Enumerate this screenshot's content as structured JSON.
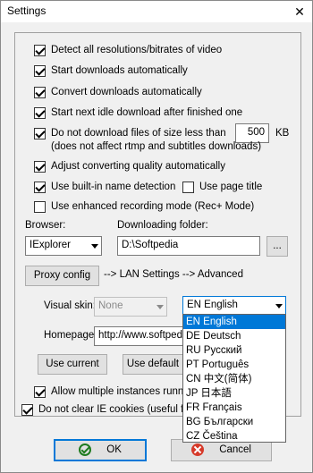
{
  "window": {
    "title": "Settings",
    "close_glyph": "✕"
  },
  "options": {
    "detect_all": {
      "label": "Detect all resolutions/bitrates of video",
      "checked": true
    },
    "start_auto": {
      "label": "Start downloads automatically",
      "checked": true
    },
    "convert_auto": {
      "label": "Convert downloads automatically",
      "checked": true
    },
    "start_next_idle": {
      "label": "Start next idle download after finished one",
      "checked": true
    },
    "no_small_files": {
      "label": "Do not download files of size less than",
      "checked": true,
      "value": "500",
      "unit": "KB",
      "note": "(does not affect rtmp and subtitles downloads)"
    },
    "adjust_quality": {
      "label": "Adjust converting quality automatically",
      "checked": true
    },
    "name_detection": {
      "label": "Use built-in name detection",
      "checked": true
    },
    "page_title": {
      "label": "Use page title",
      "checked": false
    },
    "enhanced_recording": {
      "label": "Use enhanced recording mode (Rec+ Mode)",
      "checked": false
    },
    "multiple_instances": {
      "label": "Allow multiple instances running",
      "checked": true
    },
    "ie_cookies": {
      "label": "Do not clear IE cookies (useful for",
      "checked": true
    }
  },
  "browser": {
    "label": "Browser:",
    "value": "IExplorer"
  },
  "folder": {
    "label": "Downloading folder:",
    "value": "D:\\Softpedia",
    "browse_label": "..."
  },
  "proxy": {
    "button_label": "Proxy config",
    "hint": "--> LAN Settings --> Advanced"
  },
  "visual_skin": {
    "label": "Visual skin:",
    "value": "None"
  },
  "language": {
    "value": "EN English",
    "options": [
      "EN English",
      "DE Deutsch",
      "RU Русский",
      "PT Português",
      "CN 中文(简体)",
      "JP 日本語",
      "FR Français",
      "BG Български",
      "CZ Čeština"
    ],
    "selected_index": 0
  },
  "homepage": {
    "label": "Homepage:",
    "value": "http://www.softpedia"
  },
  "use_current_label": "Use current",
  "use_default_label": "Use default",
  "footer": {
    "ok_label": "OK",
    "cancel_label": "Cancel",
    "ok_icon": "check-circle-icon",
    "cancel_icon": "cancel-x-icon"
  },
  "colors": {
    "selection": "#0078d7",
    "ok_green": "#1e7b1e",
    "cancel_red": "#d63a2a"
  }
}
